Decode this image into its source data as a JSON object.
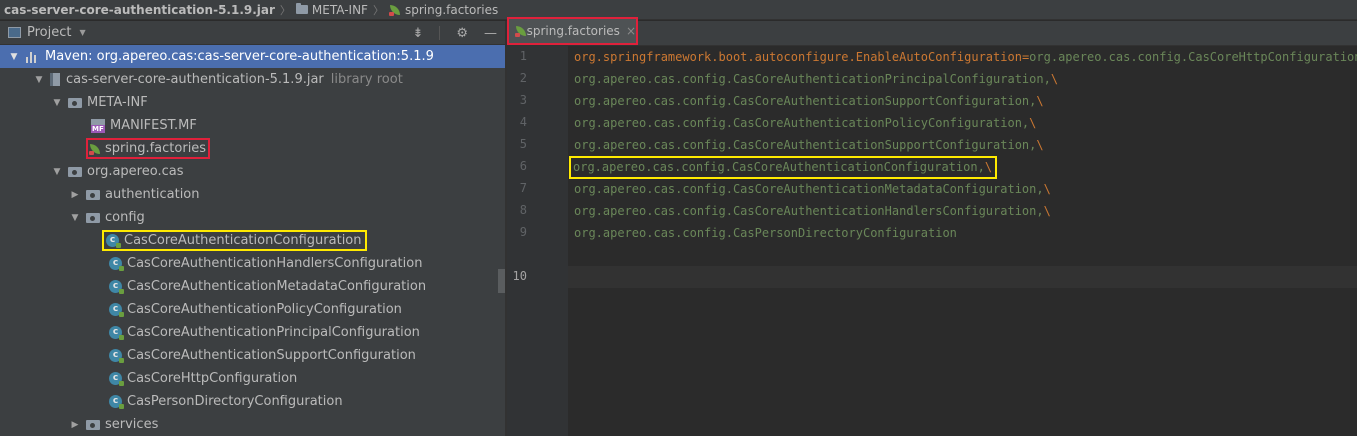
{
  "breadcrumb": {
    "jar": "cas-server-core-authentication-5.1.9.jar",
    "folder": "META-INF",
    "file": "spring.factories",
    "separator": "〉"
  },
  "project_panel": {
    "title": "Project",
    "icons": [
      "collapse-icon",
      "gear-icon",
      "minimize-icon"
    ],
    "tree": [
      {
        "label": "Maven: org.apereo.cas:cas-server-core-authentication:5.1.9",
        "selected": true
      },
      {
        "label": "cas-server-core-authentication-5.1.9.jar",
        "suffix": "library root"
      },
      {
        "label": "META-INF"
      },
      {
        "label": "MANIFEST.MF"
      },
      {
        "label": "spring.factories"
      },
      {
        "label": "org.apereo.cas"
      },
      {
        "label": "authentication"
      },
      {
        "label": "config"
      },
      {
        "label": "CasCoreAuthenticationConfiguration"
      },
      {
        "label": "CasCoreAuthenticationHandlersConfiguration"
      },
      {
        "label": "CasCoreAuthenticationMetadataConfiguration"
      },
      {
        "label": "CasCoreAuthenticationPolicyConfiguration"
      },
      {
        "label": "CasCoreAuthenticationPrincipalConfiguration"
      },
      {
        "label": "CasCoreAuthenticationSupportConfiguration"
      },
      {
        "label": "CasCoreHttpConfiguration"
      },
      {
        "label": "CasPersonDirectoryConfiguration"
      },
      {
        "label": "services"
      }
    ]
  },
  "editor": {
    "tab": {
      "label": "spring.factories",
      "close": "×"
    },
    "line_numbers": [
      "1",
      "2",
      "3",
      "4",
      "5",
      "6",
      "7",
      "8",
      "9",
      "10"
    ],
    "lines": [
      {
        "key": "org.springframework.boot.autoconfigure.EnableAutoConfiguration",
        "eq": "=",
        "value": "org.apereo.cas.config.CasCoreHttpConfiguration,",
        "esc": "\\"
      },
      {
        "value": "org.apereo.cas.config.CasCoreAuthenticationPrincipalConfiguration,",
        "esc": "\\"
      },
      {
        "value": "org.apereo.cas.config.CasCoreAuthenticationSupportConfiguration,",
        "esc": "\\"
      },
      {
        "value": "org.apereo.cas.config.CasCoreAuthenticationPolicyConfiguration,",
        "esc": "\\"
      },
      {
        "value": "org.apereo.cas.config.CasCoreAuthenticationSupportConfiguration,",
        "esc": "\\"
      },
      {
        "value": "org.apereo.cas.config.CasCoreAuthenticationConfiguration,",
        "esc": "\\"
      },
      {
        "value": "org.apereo.cas.config.CasCoreAuthenticationMetadataConfiguration,",
        "esc": "\\"
      },
      {
        "value": "org.apereo.cas.config.CasCoreAuthenticationHandlersConfiguration,",
        "esc": "\\"
      },
      {
        "value": "org.apereo.cas.config.CasPersonDirectoryConfiguration"
      }
    ]
  },
  "colors": {
    "highlight_red": "#e0213b",
    "highlight_yellow": "#ffea00",
    "selection": "#4b6eaf",
    "key": "#cc7832",
    "value": "#6a8759"
  }
}
